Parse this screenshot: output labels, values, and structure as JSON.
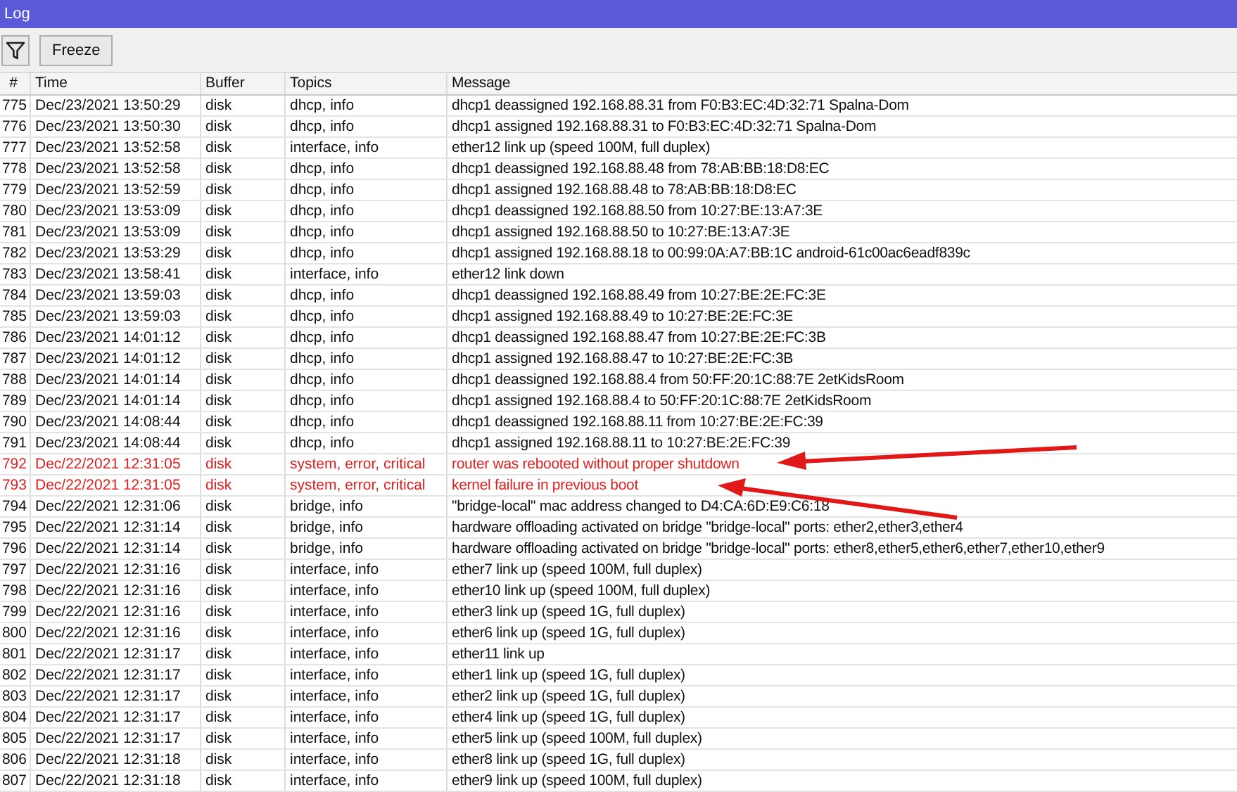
{
  "window": {
    "title": "Log"
  },
  "toolbar": {
    "freeze_button": "Freeze"
  },
  "table": {
    "columns": [
      "#",
      "Time",
      "Buffer",
      "Topics",
      "Message"
    ],
    "rows": [
      {
        "kind": "info",
        "cells": [
          "775",
          "Dec/23/2021 13:50:29",
          "disk",
          "dhcp, info",
          "dhcp1 deassigned 192.168.88.31 from F0:B3:EC:4D:32:71 Spalna-Dom"
        ]
      },
      {
        "kind": "info",
        "cells": [
          "776",
          "Dec/23/2021 13:50:30",
          "disk",
          "dhcp, info",
          "dhcp1 assigned 192.168.88.31 to F0:B3:EC:4D:32:71 Spalna-Dom"
        ]
      },
      {
        "kind": "info",
        "cells": [
          "777",
          "Dec/23/2021 13:52:58",
          "disk",
          "interface, info",
          "ether12 link up (speed 100M, full duplex)"
        ]
      },
      {
        "kind": "info",
        "cells": [
          "778",
          "Dec/23/2021 13:52:58",
          "disk",
          "dhcp, info",
          "dhcp1 deassigned 192.168.88.48 from 78:AB:BB:18:D8:EC"
        ]
      },
      {
        "kind": "info",
        "cells": [
          "779",
          "Dec/23/2021 13:52:59",
          "disk",
          "dhcp, info",
          "dhcp1 assigned 192.168.88.48 to 78:AB:BB:18:D8:EC"
        ]
      },
      {
        "kind": "info",
        "cells": [
          "780",
          "Dec/23/2021 13:53:09",
          "disk",
          "dhcp, info",
          "dhcp1 deassigned 192.168.88.50 from 10:27:BE:13:A7:3E"
        ]
      },
      {
        "kind": "info",
        "cells": [
          "781",
          "Dec/23/2021 13:53:09",
          "disk",
          "dhcp, info",
          "dhcp1 assigned 192.168.88.50 to 10:27:BE:13:A7:3E"
        ]
      },
      {
        "kind": "info",
        "cells": [
          "782",
          "Dec/23/2021 13:53:29",
          "disk",
          "dhcp, info",
          "dhcp1 assigned 192.168.88.18 to 00:99:0A:A7:BB:1C android-61c00ac6eadf839c"
        ]
      },
      {
        "kind": "info",
        "cells": [
          "783",
          "Dec/23/2021 13:58:41",
          "disk",
          "interface, info",
          "ether12 link down"
        ]
      },
      {
        "kind": "info",
        "cells": [
          "784",
          "Dec/23/2021 13:59:03",
          "disk",
          "dhcp, info",
          "dhcp1 deassigned 192.168.88.49 from 10:27:BE:2E:FC:3E"
        ]
      },
      {
        "kind": "info",
        "cells": [
          "785",
          "Dec/23/2021 13:59:03",
          "disk",
          "dhcp, info",
          "dhcp1 assigned 192.168.88.49 to 10:27:BE:2E:FC:3E"
        ]
      },
      {
        "kind": "info",
        "cells": [
          "786",
          "Dec/23/2021 14:01:12",
          "disk",
          "dhcp, info",
          "dhcp1 deassigned 192.168.88.47 from 10:27:BE:2E:FC:3B"
        ]
      },
      {
        "kind": "info",
        "cells": [
          "787",
          "Dec/23/2021 14:01:12",
          "disk",
          "dhcp, info",
          "dhcp1 assigned 192.168.88.47 to 10:27:BE:2E:FC:3B"
        ]
      },
      {
        "kind": "info",
        "cells": [
          "788",
          "Dec/23/2021 14:01:14",
          "disk",
          "dhcp, info",
          "dhcp1 deassigned 192.168.88.4 from 50:FF:20:1C:88:7E 2etKidsRoom"
        ]
      },
      {
        "kind": "info",
        "cells": [
          "789",
          "Dec/23/2021 14:01:14",
          "disk",
          "dhcp, info",
          "dhcp1 assigned 192.168.88.4 to 50:FF:20:1C:88:7E 2etKidsRoom"
        ]
      },
      {
        "kind": "info",
        "cells": [
          "790",
          "Dec/23/2021 14:08:44",
          "disk",
          "dhcp, info",
          "dhcp1 deassigned 192.168.88.11 from 10:27:BE:2E:FC:39"
        ]
      },
      {
        "kind": "info",
        "cells": [
          "791",
          "Dec/23/2021 14:08:44",
          "disk",
          "dhcp, info",
          "dhcp1 assigned 192.168.88.11 to 10:27:BE:2E:FC:39"
        ]
      },
      {
        "kind": "error",
        "cells": [
          "792",
          "Dec/22/2021 12:31:05",
          "disk",
          "system, error, critical",
          "router was rebooted without proper shutdown"
        ]
      },
      {
        "kind": "error",
        "cells": [
          "793",
          "Dec/22/2021 12:31:05",
          "disk",
          "system, error, critical",
          "kernel failure in previous boot"
        ]
      },
      {
        "kind": "info",
        "cells": [
          "794",
          "Dec/22/2021 12:31:06",
          "disk",
          "bridge, info",
          "\"bridge-local\" mac address changed to D4:CA:6D:E9:C6:18"
        ]
      },
      {
        "kind": "info",
        "cells": [
          "795",
          "Dec/22/2021 12:31:14",
          "disk",
          "bridge, info",
          "hardware offloading activated on bridge \"bridge-local\" ports: ether2,ether3,ether4"
        ]
      },
      {
        "kind": "info",
        "cells": [
          "796",
          "Dec/22/2021 12:31:14",
          "disk",
          "bridge, info",
          "hardware offloading activated on bridge \"bridge-local\" ports: ether8,ether5,ether6,ether7,ether10,ether9"
        ]
      },
      {
        "kind": "info",
        "cells": [
          "797",
          "Dec/22/2021 12:31:16",
          "disk",
          "interface, info",
          "ether7 link up (speed 100M, full duplex)"
        ]
      },
      {
        "kind": "info",
        "cells": [
          "798",
          "Dec/22/2021 12:31:16",
          "disk",
          "interface, info",
          "ether10 link up (speed 100M, full duplex)"
        ]
      },
      {
        "kind": "info",
        "cells": [
          "799",
          "Dec/22/2021 12:31:16",
          "disk",
          "interface, info",
          "ether3 link up (speed 1G, full duplex)"
        ]
      },
      {
        "kind": "info",
        "cells": [
          "800",
          "Dec/22/2021 12:31:16",
          "disk",
          "interface, info",
          "ether6 link up (speed 1G, full duplex)"
        ]
      },
      {
        "kind": "info",
        "cells": [
          "801",
          "Dec/22/2021 12:31:17",
          "disk",
          "interface, info",
          "ether11 link up"
        ]
      },
      {
        "kind": "info",
        "cells": [
          "802",
          "Dec/22/2021 12:31:17",
          "disk",
          "interface, info",
          "ether1 link up (speed 1G, full duplex)"
        ]
      },
      {
        "kind": "info",
        "cells": [
          "803",
          "Dec/22/2021 12:31:17",
          "disk",
          "interface, info",
          "ether2 link up (speed 1G, full duplex)"
        ]
      },
      {
        "kind": "info",
        "cells": [
          "804",
          "Dec/22/2021 12:31:17",
          "disk",
          "interface, info",
          "ether4 link up (speed 1G, full duplex)"
        ]
      },
      {
        "kind": "info",
        "cells": [
          "805",
          "Dec/22/2021 12:31:17",
          "disk",
          "interface, info",
          "ether5 link up (speed 100M, full duplex)"
        ]
      },
      {
        "kind": "info",
        "cells": [
          "806",
          "Dec/22/2021 12:31:18",
          "disk",
          "interface, info",
          "ether8 link up (speed 1G, full duplex)"
        ]
      },
      {
        "kind": "info",
        "cells": [
          "807",
          "Dec/22/2021 12:31:18",
          "disk",
          "interface, info",
          "ether9 link up (speed 100M, full duplex)"
        ]
      }
    ]
  }
}
